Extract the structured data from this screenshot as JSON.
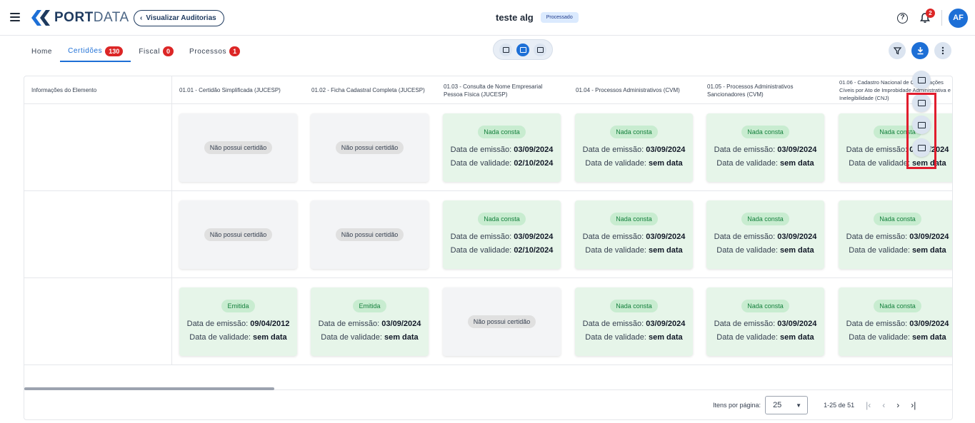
{
  "header": {
    "brand_bold": "PORT",
    "brand_light": "DATA",
    "audit_button": "Visualizar Auditorias",
    "record_name": "teste alg",
    "status": "Processado",
    "help_glyph": "?",
    "notifications_count": "2",
    "avatar_initials": "AF"
  },
  "tabs": [
    {
      "label": "Home",
      "count": null
    },
    {
      "label": "Certidões",
      "count": "130",
      "active": true
    },
    {
      "label": "Fiscal",
      "count": "0"
    },
    {
      "label": "Processos",
      "count": "1"
    }
  ],
  "table": {
    "headers": [
      "Informações do Elemento",
      "01.01 - Certidão Simplificada (JUCESP)",
      "01.02 - Ficha Cadastral Completa (JUCESP)",
      "01.03 - Consulta de Nome Empresarial Pessoa Física (JUCESP)",
      "01.04 - Processos Administrativos (CVM)",
      "01.05 - Processos Administrativos Sancionadores (CVM)",
      "01.06 - Cadastro Nacional de Condenações Cíveis por Ato de Improbidade Administrativa e Inelegibilidade (CNJ)"
    ],
    "labels": {
      "no_cert": "Não possui certidão",
      "emission": "Data de emissão:",
      "validity": "Data de validade:"
    },
    "rows": [
      [
        {
          "type": "none"
        },
        {
          "type": "none"
        },
        {
          "type": "ok",
          "status": "Nada consta",
          "emission": "03/09/2024",
          "validity": "02/10/2024"
        },
        {
          "type": "ok",
          "status": "Nada consta",
          "emission": "03/09/2024",
          "validity": "sem data"
        },
        {
          "type": "ok",
          "status": "Nada consta",
          "emission": "03/09/2024",
          "validity": "sem data"
        },
        {
          "type": "ok",
          "status": "Nada consta",
          "emission": "03/09/2024",
          "validity": "sem data"
        }
      ],
      [
        {
          "type": "none"
        },
        {
          "type": "none"
        },
        {
          "type": "ok",
          "status": "Nada consta",
          "emission": "03/09/2024",
          "validity": "02/10/2024"
        },
        {
          "type": "ok",
          "status": "Nada consta",
          "emission": "03/09/2024",
          "validity": "sem data"
        },
        {
          "type": "ok",
          "status": "Nada consta",
          "emission": "03/09/2024",
          "validity": "sem data"
        },
        {
          "type": "ok",
          "status": "Nada consta",
          "emission": "03/09/2024",
          "validity": "sem data"
        }
      ],
      [
        {
          "type": "ok",
          "status": "Emitida",
          "emission": "09/04/2012",
          "validity": "sem data"
        },
        {
          "type": "ok",
          "status": "Emitida",
          "emission": "03/09/2024",
          "validity": "sem data"
        },
        {
          "type": "none"
        },
        {
          "type": "ok",
          "status": "Nada consta",
          "emission": "03/09/2024",
          "validity": "sem data"
        },
        {
          "type": "ok",
          "status": "Nada consta",
          "emission": "03/09/2024",
          "validity": "sem data"
        },
        {
          "type": "ok",
          "status": "Nada consta",
          "emission": "03/09/2024",
          "validity": "sem data"
        }
      ]
    ]
  },
  "pagination": {
    "items_per_page_label": "Itens por página:",
    "items_per_page": "25",
    "range": "1-25 de 51"
  },
  "export_menu": {
    "items": [
      "folder-export-icon",
      "excel-export-icon",
      "table-export-icon",
      "table-alt-export-icon"
    ],
    "highlight_color": "#e11d2e"
  },
  "colors": {
    "accent": "#1d6fd6",
    "danger": "#dc2626",
    "success_bg": "#e6f5e9",
    "success_text": "#15803d"
  }
}
